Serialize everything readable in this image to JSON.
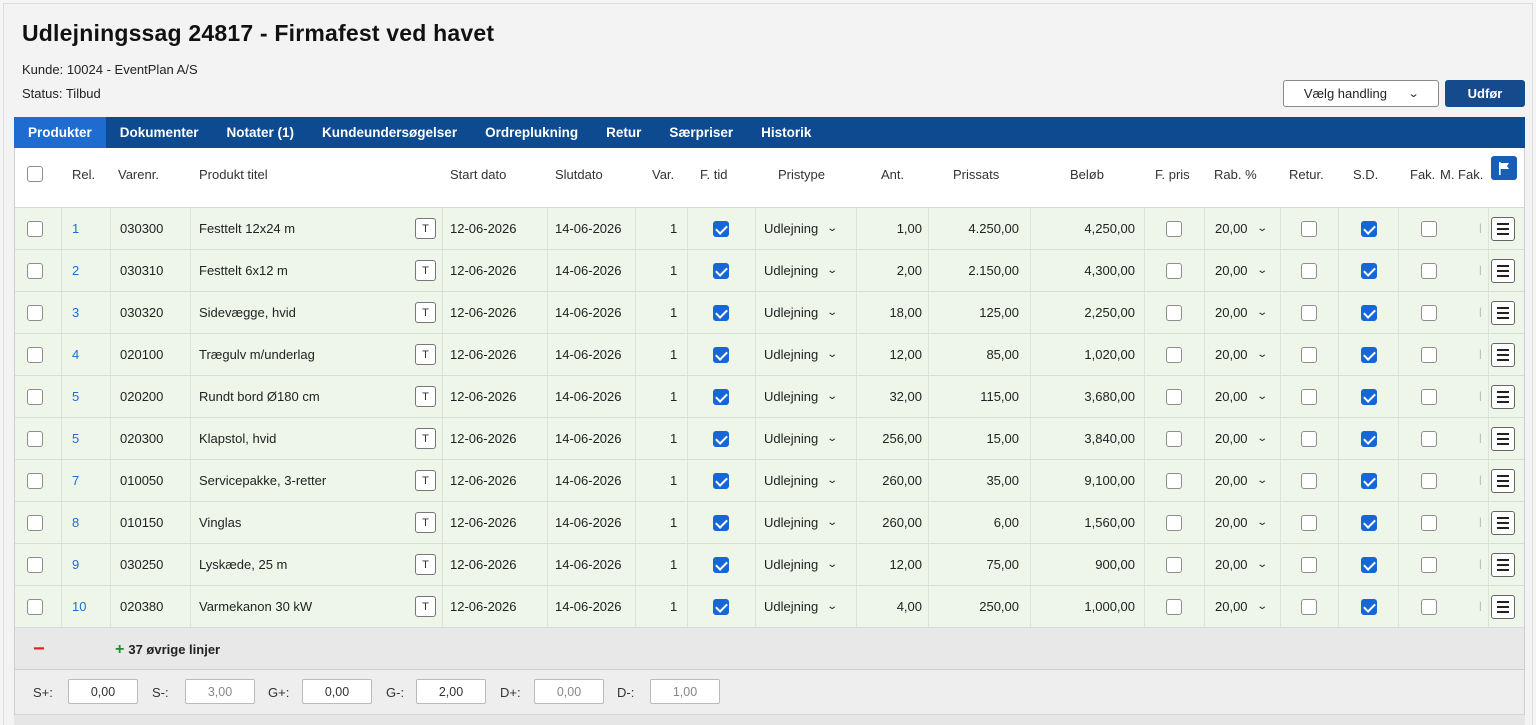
{
  "header": {
    "title": "Udlejningssag 24817 - Firmafest ved havet",
    "customer": "Kunde: 10024 - EventPlan A/S",
    "status": "Status: Tilbud"
  },
  "actions": {
    "select_label": "Vælg handling",
    "run_label": "Udfør"
  },
  "tabs": [
    "Produkter",
    "Dokumenter",
    "Notater (1)",
    "Kundeundersøgelser",
    "Ordreplukning",
    "Retur",
    "Særpriser",
    "Historik"
  ],
  "columns": {
    "rel": "Rel.",
    "varenr": "Varenr.",
    "title": "Produkt titel",
    "start": "Start dato",
    "end": "Slutdato",
    "var": "Var.",
    "ftid": "F. tid",
    "pristype": "Pristype",
    "ant": "Ant.",
    "prissats": "Prissats",
    "belob": "Beløb",
    "fpris": "F. pris",
    "rab": "Rab. %",
    "retur": "Retur.",
    "sd": "S.D.",
    "fak": "Fak.",
    "mfak": "M. Fak."
  },
  "text_button_label": "T",
  "rows": [
    {
      "rel": "1",
      "varenr": "030300",
      "title": "Festtelt 12x24 m",
      "start": "12-06-2026",
      "end": "14-06-2026",
      "var": "1",
      "pristype": "Udlejning",
      "ant": "1,00",
      "prissats": "4.250,00",
      "belob": "4,250,00",
      "rab": "20,00"
    },
    {
      "rel": "2",
      "varenr": "030310",
      "title": "Festtelt 6x12 m",
      "start": "12-06-2026",
      "end": "14-06-2026",
      "var": "1",
      "pristype": "Udlejning",
      "ant": "2,00",
      "prissats": "2.150,00",
      "belob": "4,300,00",
      "rab": "20,00"
    },
    {
      "rel": "3",
      "varenr": "030320",
      "title": "Sidevægge, hvid",
      "start": "12-06-2026",
      "end": "14-06-2026",
      "var": "1",
      "pristype": "Udlejning",
      "ant": "18,00",
      "prissats": "125,00",
      "belob": "2,250,00",
      "rab": "20,00"
    },
    {
      "rel": "4",
      "varenr": "020100",
      "title": "Trægulv m/underlag",
      "start": "12-06-2026",
      "end": "14-06-2026",
      "var": "1",
      "pristype": "Udlejning",
      "ant": "12,00",
      "prissats": "85,00",
      "belob": "1,020,00",
      "rab": "20,00"
    },
    {
      "rel": "5",
      "varenr": "020200",
      "title": "Rundt bord Ø180 cm",
      "start": "12-06-2026",
      "end": "14-06-2026",
      "var": "1",
      "pristype": "Udlejning",
      "ant": "32,00",
      "prissats": "115,00",
      "belob": "3,680,00",
      "rab": "20,00"
    },
    {
      "rel": "5",
      "varenr": "020300",
      "title": "Klapstol, hvid",
      "start": "12-06-2026",
      "end": "14-06-2026",
      "var": "1",
      "pristype": "Udlejning",
      "ant": "256,00",
      "prissats": "15,00",
      "belob": "3,840,00",
      "rab": "20,00"
    },
    {
      "rel": "7",
      "varenr": "010050",
      "title": "Servicepakke, 3-retter",
      "start": "12-06-2026",
      "end": "14-06-2026",
      "var": "1",
      "pristype": "Udlejning",
      "ant": "260,00",
      "prissats": "35,00",
      "belob": "9,100,00",
      "rab": "20,00"
    },
    {
      "rel": "8",
      "varenr": "010150",
      "title": "Vinglas",
      "start": "12-06-2026",
      "end": "14-06-2026",
      "var": "1",
      "pristype": "Udlejning",
      "ant": "260,00",
      "prissats": "6,00",
      "belob": "1,560,00",
      "rab": "20,00"
    },
    {
      "rel": "9",
      "varenr": "030250",
      "title": "Lyskæde, 25 m",
      "start": "12-06-2026",
      "end": "14-06-2026",
      "var": "1",
      "pristype": "Udlejning",
      "ant": "12,00",
      "prissats": "75,00",
      "belob": "900,00",
      "rab": "20,00"
    },
    {
      "rel": "10",
      "varenr": "020380",
      "title": "Varmekanon 30 kW",
      "start": "12-06-2026",
      "end": "14-06-2026",
      "var": "1",
      "pristype": "Udlejning",
      "ant": "4,00",
      "prissats": "250,00",
      "belob": "1,000,00",
      "rab": "20,00"
    }
  ],
  "footer": {
    "minus": "−",
    "plus": "+",
    "more_lines": "37 øvrige linjer"
  },
  "sums": [
    {
      "label": "S+:",
      "value": "0,00"
    },
    {
      "label": "S-:",
      "value": "3,00"
    },
    {
      "label": "G+:",
      "value": "0,00"
    },
    {
      "label": "G-:",
      "value": "2,00"
    },
    {
      "label": "D+:",
      "value": "0,00"
    },
    {
      "label": "D-:",
      "value": "1,00"
    }
  ],
  "colors": {
    "tabbar": "#0e4a8f",
    "tab_active": "#1e6ccf",
    "row_bg": "#eef6ea",
    "checkbox_on": "#1766d8",
    "button": "#154a8c"
  }
}
